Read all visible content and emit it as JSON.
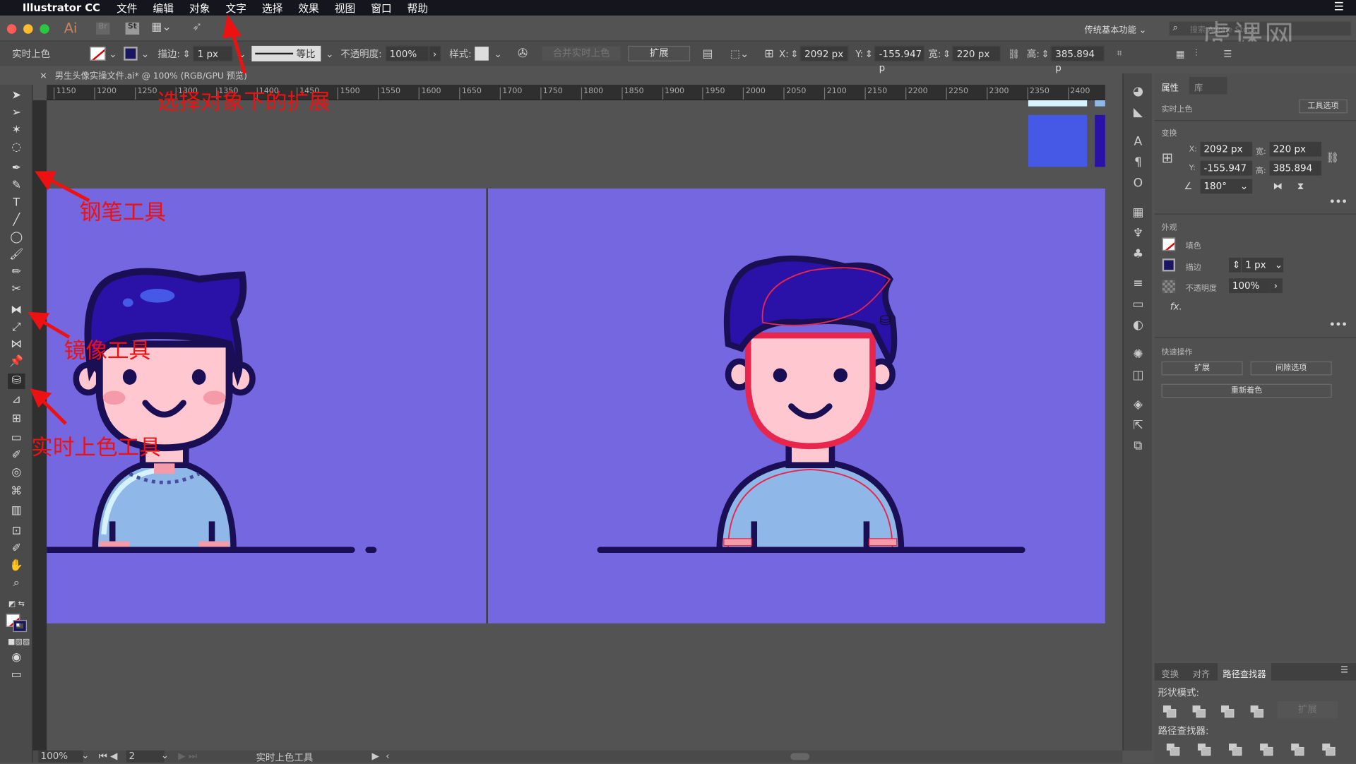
{
  "menubar": {
    "app": "Illustrator CC",
    "items": [
      "文件",
      "编辑",
      "对象",
      "文字",
      "选择",
      "效果",
      "视图",
      "窗口",
      "帮助"
    ]
  },
  "appbar": {
    "logo": "Ai",
    "br": "Br",
    "st": "St",
    "workspace": "传统基本功能",
    "search_placeholder": "搜索 Adobe Stock",
    "watermark": "虎课网"
  },
  "control": {
    "mode": "实时上色",
    "stroke_label": "描边:",
    "stroke_value": "1 px",
    "stroke_profile": "等比",
    "opacity_label": "不透明度:",
    "opacity_value": "100%",
    "style_label": "样式:",
    "merge_label": "合并实时上色",
    "expand_label": "扩展",
    "x_label": "X:",
    "x_value": "2092 px",
    "y_label": "Y:",
    "y_value": "-155.947 p",
    "w_label": "宽:",
    "w_value": "220 px",
    "h_label": "高:",
    "h_value": "385.894 p"
  },
  "document": {
    "tab_title": "男生头像实操文件.ai* @ 100% (RGB/GPU 预览)"
  },
  "ruler": {
    "ticks": [
      "1150",
      "1200",
      "1250",
      "1300",
      "1350",
      "1400",
      "1450",
      "1500",
      "1550",
      "1600",
      "1650",
      "1700",
      "1750",
      "1800",
      "1850",
      "1900",
      "1950",
      "2000",
      "2050",
      "2100",
      "2150",
      "2200",
      "2250",
      "2300",
      "2350",
      "2400"
    ]
  },
  "colors": {
    "artboard": "#7467df",
    "swatch_blue": "#4559e6",
    "swatch_navy": "#2a12a8",
    "swatch_light": "#d4f3ff",
    "annotation": "#ee1111",
    "selection": "#e8264d"
  },
  "annotations": {
    "expand": "选择对象下的扩展",
    "pen": "钢笔工具",
    "mirror": "镜像工具",
    "live_paint": "实时上色工具"
  },
  "properties": {
    "tab_props": "属性",
    "tab_library": "库",
    "context": "实时上色",
    "tool_options": "工具选项",
    "transform_title": "变换",
    "x_label": "X:",
    "x": "2092 px",
    "y_label": "Y:",
    "y": "-155.947",
    "w_label": "宽:",
    "w": "220 px",
    "h_label": "高:",
    "h": "385.894",
    "angle": "180°",
    "appearance_title": "外观",
    "fill": "填色",
    "stroke": "描边",
    "stroke_value": "1 px",
    "opacity": "不透明度",
    "opacity_value": "100%",
    "fx": "fx.",
    "quick_title": "快速操作",
    "expand": "扩展",
    "gap_options": "间隙选项",
    "recolor": "重新着色"
  },
  "pathfinder": {
    "tabs": [
      "变换",
      "对齐",
      "路径查找器"
    ],
    "shape_modes": "形状模式:",
    "expand": "扩展",
    "pathfinders": "路径查找器:"
  },
  "status": {
    "zoom": "100%",
    "artboard": "2",
    "tool": "实时上色工具"
  }
}
